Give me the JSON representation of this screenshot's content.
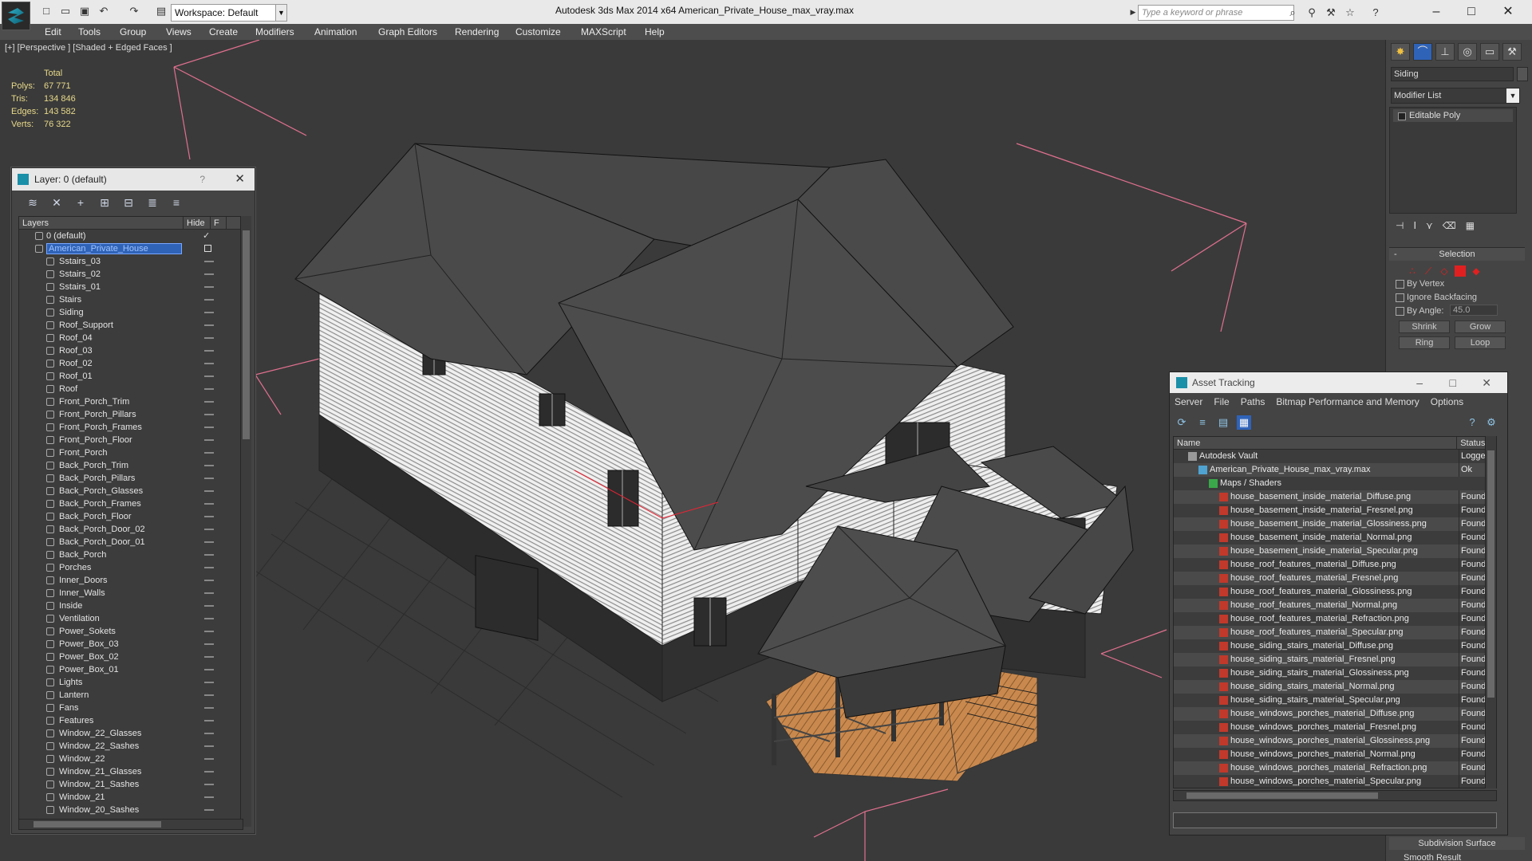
{
  "window": {
    "title": "Autodesk 3ds Max  2014 x64      American_Private_House_max_vray.max",
    "workspace": "Workspace: Default",
    "search_placeholder": "Type a keyword or phrase"
  },
  "menu": [
    "Edit",
    "Tools",
    "Group",
    "Views",
    "Create",
    "Modifiers",
    "Animation",
    "Graph Editors",
    "Rendering",
    "Customize",
    "MAXScript",
    "Help"
  ],
  "viewport": {
    "label": "[+] [Perspective ] [Shaded + Edged Faces ]",
    "stats": {
      "header": "Total",
      "rows": [
        {
          "k": "Polys:",
          "v": "67 771"
        },
        {
          "k": "Tris:",
          "v": "134 846"
        },
        {
          "k": "Edges:",
          "v": "143 582"
        },
        {
          "k": "Verts:",
          "v": "76 322"
        }
      ]
    }
  },
  "layer_dialog": {
    "title": "Layer: 0 (default)",
    "help": "?",
    "col_layers": "Layers",
    "col_hide": "Hide",
    "col_f": "F",
    "rows": [
      {
        "name": "0 (default)",
        "level": 0,
        "mark": "check"
      },
      {
        "name": "American_Private_House",
        "level": 1,
        "mark": "box",
        "selected": true
      },
      {
        "name": "Sstairs_03"
      },
      {
        "name": "Sstairs_02"
      },
      {
        "name": "Sstairs_01"
      },
      {
        "name": "Stairs"
      },
      {
        "name": "Siding"
      },
      {
        "name": "Roof_Support"
      },
      {
        "name": "Roof_04"
      },
      {
        "name": "Roof_03"
      },
      {
        "name": "Roof_02"
      },
      {
        "name": "Roof_01"
      },
      {
        "name": "Roof"
      },
      {
        "name": "Front_Porch_Trim"
      },
      {
        "name": "Front_Porch_Pillars"
      },
      {
        "name": "Front_Porch_Frames"
      },
      {
        "name": "Front_Porch_Floor"
      },
      {
        "name": "Front_Porch"
      },
      {
        "name": "Back_Porch_Trim"
      },
      {
        "name": "Back_Porch_Pillars"
      },
      {
        "name": "Back_Porch_Glasses"
      },
      {
        "name": "Back_Porch_Frames"
      },
      {
        "name": "Back_Porch_Floor"
      },
      {
        "name": "Back_Porch_Door_02"
      },
      {
        "name": "Back_Porch_Door_01"
      },
      {
        "name": "Back_Porch"
      },
      {
        "name": "Porches"
      },
      {
        "name": "Inner_Doors"
      },
      {
        "name": "Inner_Walls"
      },
      {
        "name": "Inside"
      },
      {
        "name": "Ventilation"
      },
      {
        "name": "Power_Sokets"
      },
      {
        "name": "Power_Box_03"
      },
      {
        "name": "Power_Box_02"
      },
      {
        "name": "Power_Box_01"
      },
      {
        "name": "Lights"
      },
      {
        "name": "Lantern"
      },
      {
        "name": "Fans"
      },
      {
        "name": "Features"
      },
      {
        "name": "Window_22_Glasses"
      },
      {
        "name": "Window_22_Sashes"
      },
      {
        "name": "Window_22"
      },
      {
        "name": "Window_21_Glasses"
      },
      {
        "name": "Window_21_Sashes"
      },
      {
        "name": "Window_21"
      },
      {
        "name": "Window_20_Sashes"
      }
    ]
  },
  "command_panel": {
    "object_name": "Siding",
    "modifier_list": "Modifier List",
    "stack_item": "Editable Poly",
    "selection_title": "Selection",
    "by_vertex": "By Vertex",
    "ignore_backfacing": "Ignore Backfacing",
    "by_angle": "By Angle:",
    "angle_value": "45.0",
    "shrink": "Shrink",
    "grow": "Grow",
    "ring": "Ring",
    "loop": "Loop",
    "subdivision": "Subdivision Surface",
    "smooth_result": "Smooth Result"
  },
  "asset_tracking": {
    "title": "Asset Tracking",
    "menu": [
      "Server",
      "File",
      "Paths",
      "Bitmap Performance and Memory",
      "Options"
    ],
    "col_name": "Name",
    "col_status": "Status",
    "rows": [
      {
        "name": "Autodesk Vault",
        "status": "Logged",
        "indent": 0,
        "icon": "vault"
      },
      {
        "name": "American_Private_House_max_vray.max",
        "status": "Ok",
        "indent": 1,
        "icon": "max"
      },
      {
        "name": "Maps / Shaders",
        "status": "",
        "indent": 2,
        "icon": "maps"
      },
      {
        "name": "house_basement_inside_material_Diffuse.png",
        "status": "Found",
        "indent": 3,
        "icon": "png"
      },
      {
        "name": "house_basement_inside_material_Fresnel.png",
        "status": "Found",
        "indent": 3,
        "icon": "png"
      },
      {
        "name": "house_basement_inside_material_Glossiness.png",
        "status": "Found",
        "indent": 3,
        "icon": "png"
      },
      {
        "name": "house_basement_inside_material_Normal.png",
        "status": "Found",
        "indent": 3,
        "icon": "png"
      },
      {
        "name": "house_basement_inside_material_Specular.png",
        "status": "Found",
        "indent": 3,
        "icon": "png"
      },
      {
        "name": "house_roof_features_material_Diffuse.png",
        "status": "Found",
        "indent": 3,
        "icon": "png"
      },
      {
        "name": "house_roof_features_material_Fresnel.png",
        "status": "Found",
        "indent": 3,
        "icon": "png"
      },
      {
        "name": "house_roof_features_material_Glossiness.png",
        "status": "Found",
        "indent": 3,
        "icon": "png"
      },
      {
        "name": "house_roof_features_material_Normal.png",
        "status": "Found",
        "indent": 3,
        "icon": "png"
      },
      {
        "name": "house_roof_features_material_Refraction.png",
        "status": "Found",
        "indent": 3,
        "icon": "png"
      },
      {
        "name": "house_roof_features_material_Specular.png",
        "status": "Found",
        "indent": 3,
        "icon": "png"
      },
      {
        "name": "house_siding_stairs_material_Diffuse.png",
        "status": "Found",
        "indent": 3,
        "icon": "png"
      },
      {
        "name": "house_siding_stairs_material_Fresnel.png",
        "status": "Found",
        "indent": 3,
        "icon": "png"
      },
      {
        "name": "house_siding_stairs_material_Glossiness.png",
        "status": "Found",
        "indent": 3,
        "icon": "png"
      },
      {
        "name": "house_siding_stairs_material_Normal.png",
        "status": "Found",
        "indent": 3,
        "icon": "png"
      },
      {
        "name": "house_siding_stairs_material_Specular.png",
        "status": "Found",
        "indent": 3,
        "icon": "png"
      },
      {
        "name": "house_windows_porches_material_Diffuse.png",
        "status": "Found",
        "indent": 3,
        "icon": "png"
      },
      {
        "name": "house_windows_porches_material_Fresnel.png",
        "status": "Found",
        "indent": 3,
        "icon": "png"
      },
      {
        "name": "house_windows_porches_material_Glossiness.png",
        "status": "Found",
        "indent": 3,
        "icon": "png"
      },
      {
        "name": "house_windows_porches_material_Normal.png",
        "status": "Found",
        "indent": 3,
        "icon": "png"
      },
      {
        "name": "house_windows_porches_material_Refraction.png",
        "status": "Found",
        "indent": 3,
        "icon": "png"
      },
      {
        "name": "house_windows_porches_material_Specular.png",
        "status": "Found",
        "indent": 3,
        "icon": "png"
      }
    ]
  },
  "colors": {
    "menubar": "#4d4d4d",
    "viewport": "#3a3a3a",
    "stats": "#e8d98a",
    "selection_blue": "#2f63b8",
    "png_icon": "#c0392b"
  }
}
